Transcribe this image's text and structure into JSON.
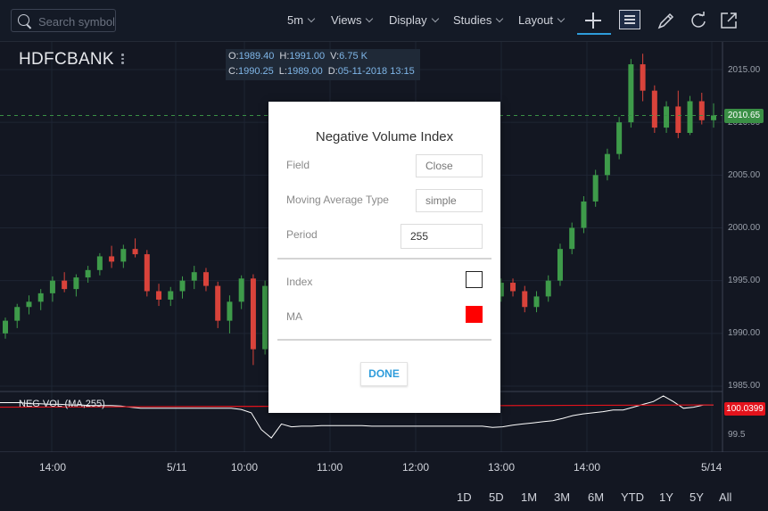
{
  "toolbar": {
    "search_placeholder": "Search symbol",
    "interval_label": "5m",
    "views_label": "Views",
    "display_label": "Display",
    "studies_label": "Studies",
    "layout_label": "Layout",
    "icons": [
      "search-icon",
      "crosshair-icon",
      "comment-icon",
      "pencil-icon",
      "redo-icon",
      "share-icon"
    ]
  },
  "symbol": "HDFCBANK",
  "ohlc": {
    "o_key": "O:",
    "o": "1989.40",
    "h_key": "H:",
    "h": "1991.00",
    "v_key": "V:",
    "v": "6.75 K",
    "c_key": "C:",
    "c": "1990.25",
    "l_key": "L:",
    "l": "1989.00",
    "d_key": "D:",
    "d": "05-11-2018 13:15"
  },
  "price_axis": [
    "2015.00",
    "2010.00",
    "2005.00",
    "2000.00",
    "1995.00",
    "1990.00",
    "1985.00"
  ],
  "current_price": "2010.65",
  "study": {
    "label": "NEG VOL (MA,255)",
    "axis_label": "99.5",
    "current_value": "100.0399"
  },
  "time_axis": [
    "14:00",
    "5/11",
    "10:00",
    "11:00",
    "12:00",
    "13:00",
    "14:00",
    "5/14"
  ],
  "ranges": [
    "1D",
    "5D",
    "1M",
    "3M",
    "6M",
    "YTD",
    "1Y",
    "5Y",
    "All"
  ],
  "dialog": {
    "title": "Negative Volume Index",
    "field_label": "Field",
    "field_value": "Close",
    "ma_type_label": "Moving Average Type",
    "ma_type_value": "simple",
    "period_label": "Period",
    "period_value": "255",
    "index_label": "Index",
    "index_color": "#ffffff",
    "ma_label": "MA",
    "ma_color": "#ff0000",
    "done_label": "DONE"
  },
  "colors": {
    "background": "#131722",
    "up": "#3e9b4a",
    "down": "#d9433b",
    "accent": "#2e9cdb"
  },
  "chart_data": {
    "type": "candlestick",
    "symbol": "HDFCBANK",
    "interval": "5m",
    "ylim": [
      1984.5,
      2017.5
    ],
    "candles": [
      [
        1990.0,
        1991.5,
        1989.5,
        1991.2
      ],
      [
        1991.2,
        1992.8,
        1990.5,
        1992.5
      ],
      [
        1992.5,
        1993.6,
        1991.8,
        1993.0
      ],
      [
        1993.0,
        1994.2,
        1992.2,
        1993.8
      ],
      [
        1993.8,
        1995.4,
        1993.0,
        1995.0
      ],
      [
        1995.0,
        1995.8,
        1993.9,
        1994.2
      ],
      [
        1994.2,
        1995.6,
        1993.5,
        1995.3
      ],
      [
        1995.3,
        1996.4,
        1994.8,
        1996.0
      ],
      [
        1996.0,
        1997.6,
        1995.5,
        1997.3
      ],
      [
        1997.3,
        1998.3,
        1996.2,
        1996.8
      ],
      [
        1996.8,
        1998.4,
        1996.2,
        1998.0
      ],
      [
        1998.0,
        1999.0,
        1997.2,
        1997.5
      ],
      [
        1997.5,
        1997.9,
        1993.5,
        1994.0
      ],
      [
        1994.0,
        1994.7,
        1992.6,
        1993.2
      ],
      [
        1993.2,
        1994.4,
        1992.6,
        1994.0
      ],
      [
        1994.0,
        1995.4,
        1993.3,
        1995.0
      ],
      [
        1995.0,
        1996.4,
        1994.2,
        1995.8
      ],
      [
        1995.8,
        1996.2,
        1994.0,
        1994.5
      ],
      [
        1994.5,
        1994.9,
        1990.5,
        1991.2
      ],
      [
        1991.2,
        1993.6,
        1990.0,
        1993.0
      ],
      [
        1993.0,
        1995.5,
        1992.3,
        1995.2
      ],
      [
        1995.2,
        1995.6,
        1987.0,
        1988.5
      ],
      [
        1988.5,
        1995.0,
        1988.0,
        1994.5
      ],
      [
        1994.5,
        1995.2,
        1991.0,
        1991.5
      ],
      [
        1991.5,
        1992.0,
        1987.5,
        1989.0
      ],
      [
        1989.0,
        1989.6,
        1986.2,
        1986.8
      ],
      [
        1986.8,
        1988.0,
        1986.0,
        1987.6
      ],
      [
        1987.6,
        1988.6,
        1987.0,
        1988.3
      ],
      [
        1988.3,
        1989.6,
        1987.8,
        1989.0
      ],
      [
        1989.0,
        1991.0,
        1988.6,
        1990.6
      ],
      [
        1990.6,
        1991.4,
        1989.4,
        1990.2
      ],
      [
        1990.2,
        1991.2,
        1989.3,
        1990.0
      ],
      [
        1990.0,
        1992.5,
        1989.5,
        1992.0
      ],
      [
        1992.0,
        1992.4,
        1988.0,
        1989.0
      ],
      [
        1989.0,
        1990.5,
        1988.0,
        1990.0
      ],
      [
        1990.0,
        1991.5,
        1989.0,
        1991.0
      ],
      [
        1991.0,
        1992.5,
        1990.5,
        1992.0
      ],
      [
        1992.0,
        1993.4,
        1991.5,
        1993.0
      ],
      [
        1993.0,
        1994.0,
        1992.5,
        1993.5
      ],
      [
        1993.5,
        1994.5,
        1993.0,
        1994.0
      ],
      [
        1994.0,
        1995.5,
        1993.5,
        1995.0
      ],
      [
        1995.0,
        1995.5,
        1993.0,
        1993.5
      ],
      [
        1993.5,
        1995.2,
        1993.0,
        1994.8
      ],
      [
        1994.8,
        1995.2,
        1993.5,
        1994.0
      ],
      [
        1994.0,
        1994.5,
        1992.0,
        1992.5
      ],
      [
        1992.5,
        1994.0,
        1992.0,
        1993.5
      ],
      [
        1993.5,
        1995.5,
        1993.0,
        1995.0
      ],
      [
        1995.0,
        1998.5,
        1994.5,
        1998.0
      ],
      [
        1998.0,
        2000.5,
        1997.5,
        2000.0
      ],
      [
        2000.0,
        2003.0,
        1999.5,
        2002.5
      ],
      [
        2002.5,
        2005.5,
        2002.0,
        2005.0
      ],
      [
        2005.0,
        2007.5,
        2004.5,
        2007.0
      ],
      [
        2007.0,
        2010.5,
        2006.5,
        2010.0
      ],
      [
        2010.0,
        2016.0,
        2009.5,
        2015.5
      ],
      [
        2015.5,
        2016.5,
        2012.0,
        2013.0
      ],
      [
        2013.0,
        2013.5,
        2009.0,
        2009.5
      ],
      [
        2009.5,
        2012.0,
        2009.0,
        2011.5
      ],
      [
        2011.5,
        2013.0,
        2008.5,
        2009.0
      ],
      [
        2009.0,
        2012.5,
        2008.8,
        2012.0
      ],
      [
        2012.0,
        2012.8,
        2009.8,
        2010.2
      ],
      [
        2010.2,
        2011.8,
        2009.5,
        2010.65
      ]
    ],
    "study": {
      "name": "Negative Volume Index",
      "ma_period": 255,
      "nvi": [
        100.08,
        100.08,
        100.08,
        100.06,
        100.06,
        100.05,
        100.05,
        100.04,
        100.04,
        100.03,
        100.03,
        100.03,
        100.02,
        100.0,
        99.98,
        99.98,
        99.98,
        99.98,
        99.98,
        99.98,
        99.98,
        99.98,
        99.98,
        99.98,
        99.96,
        99.9,
        99.6,
        99.45,
        99.7,
        99.65,
        99.66,
        99.66,
        99.67,
        99.67,
        99.67,
        99.67,
        99.67,
        99.66,
        99.66,
        99.66,
        99.66,
        99.66,
        99.66,
        99.66,
        99.66,
        99.66,
        99.66,
        99.66,
        99.66,
        99.64,
        99.65,
        99.68,
        99.7,
        99.72,
        99.74,
        99.76,
        99.8,
        99.85,
        99.88,
        99.9,
        99.92,
        99.95,
        99.95,
        100.0,
        100.05,
        100.1,
        100.2,
        100.1,
        99.98,
        100.0,
        100.04,
        100.04
      ],
      "ma": [
        100.0,
        100.04
      ]
    }
  }
}
